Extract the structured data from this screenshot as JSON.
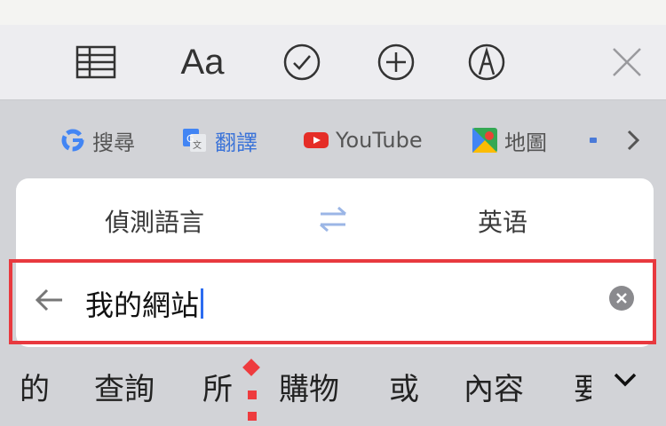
{
  "toolbar": {
    "items": [
      {
        "name": "table-icon"
      },
      {
        "name": "text-format",
        "label": "Aa"
      },
      {
        "name": "checkmark-circle-icon"
      },
      {
        "name": "add-circle-icon"
      },
      {
        "name": "markup-pen-icon"
      },
      {
        "name": "close-icon"
      }
    ]
  },
  "shortcuts": {
    "items": [
      {
        "icon": "google-icon",
        "label": "搜尋"
      },
      {
        "icon": "google-translate-icon",
        "label": "翻譯"
      },
      {
        "icon": "youtube-icon",
        "label": "YouTube"
      },
      {
        "icon": "google-maps-icon",
        "label": "地圖"
      }
    ],
    "more_icon": "chevron-right-icon"
  },
  "translate": {
    "source_lang": "偵測語言",
    "target_lang": "英语",
    "input_value": "我的網站"
  },
  "candidates": [
    "的",
    "查詢",
    "所",
    "購物",
    "或",
    "內容",
    "要"
  ],
  "colors": {
    "accent": "#3c74d8",
    "highlight": "#e8393f"
  }
}
